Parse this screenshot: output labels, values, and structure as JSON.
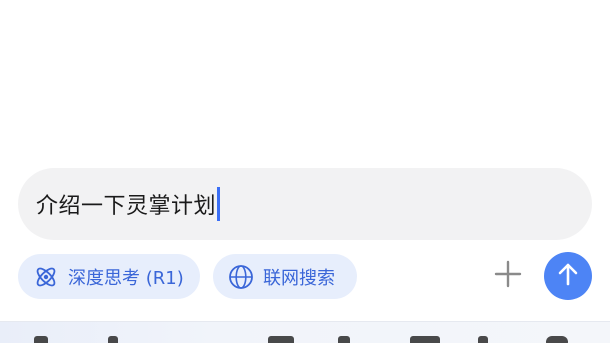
{
  "composer": {
    "input_value": "介绍一下灵掌计划",
    "caret_color": "#3b6ff5",
    "background": "#f2f2f3"
  },
  "chips": {
    "deep_think": {
      "label": "深度思考 (R1)",
      "icon": "atom-icon"
    },
    "web_search": {
      "label": "联网搜索",
      "icon": "globe-icon"
    },
    "chip_background": "#e7eefc",
    "chip_text_color": "#3a66d8"
  },
  "actions": {
    "attach_icon": "plus-icon",
    "send_icon": "arrow-up-icon",
    "send_color": "#4d84f5"
  }
}
